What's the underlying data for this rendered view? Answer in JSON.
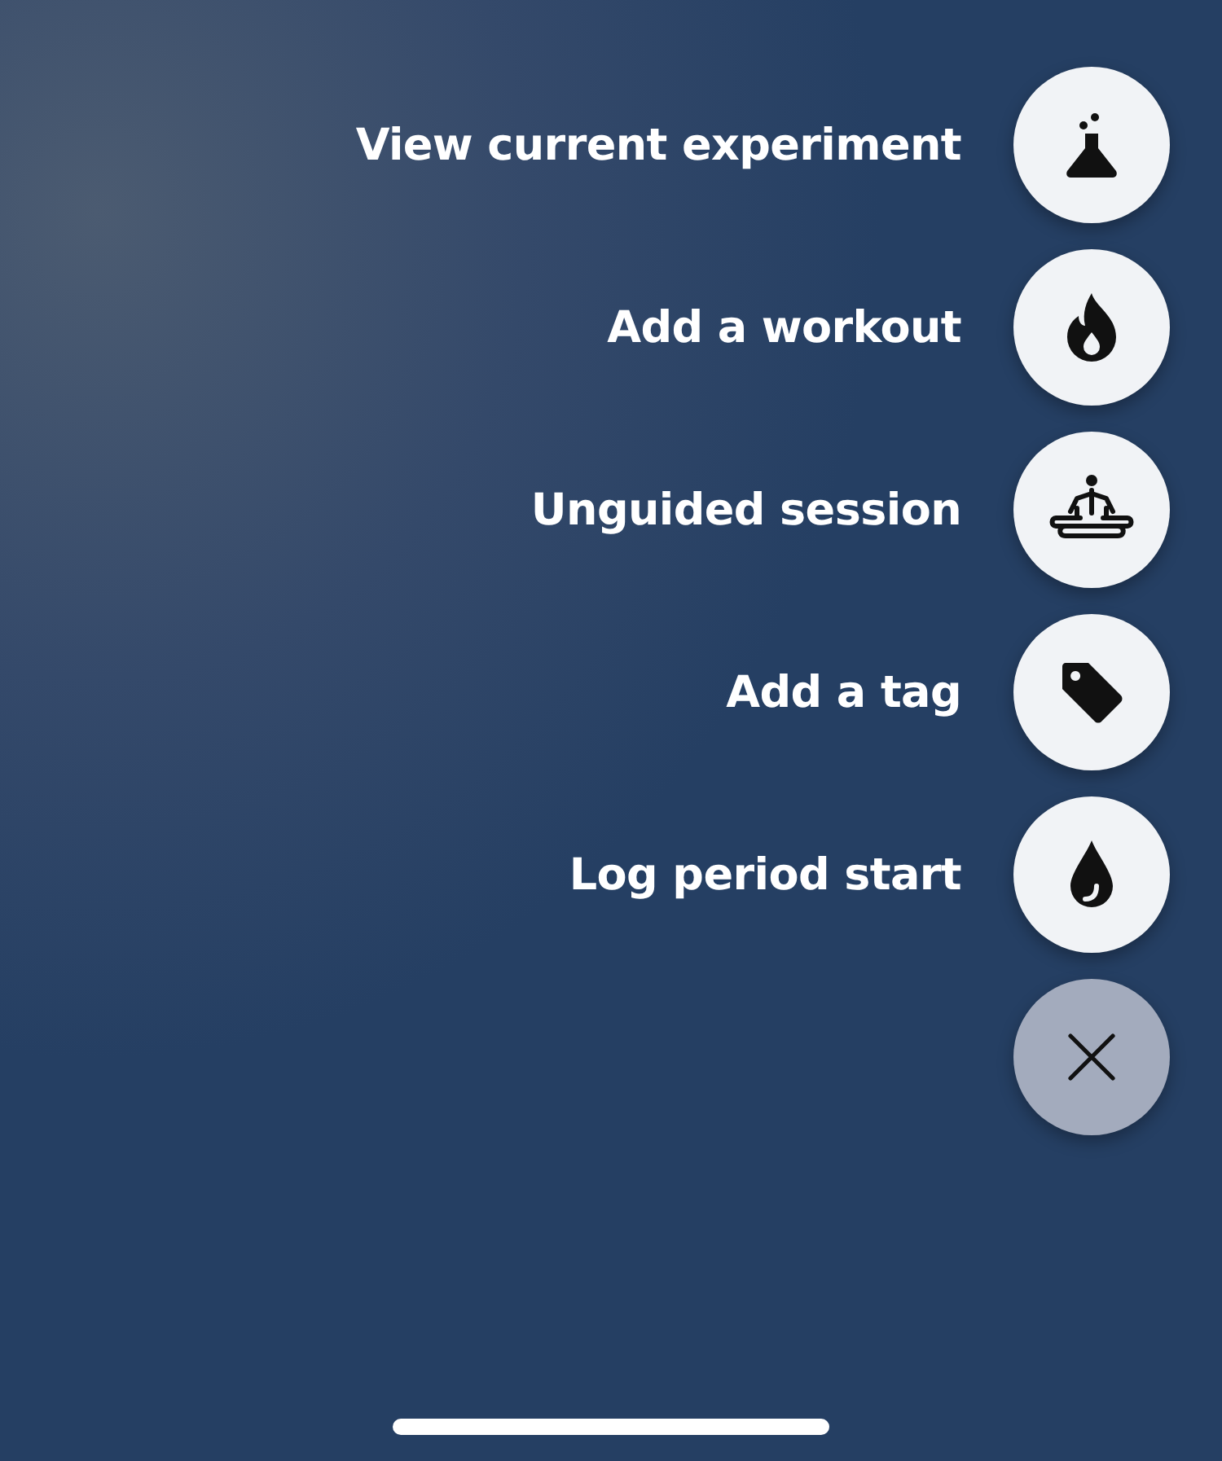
{
  "actions": [
    {
      "label": "View current experiment",
      "kind": "experiment"
    },
    {
      "label": "Add a workout",
      "kind": "workout"
    },
    {
      "label": "Unguided session",
      "kind": "meditation"
    },
    {
      "label": "Add a tag",
      "kind": "tag"
    },
    {
      "label": "Log period start",
      "kind": "period"
    }
  ]
}
